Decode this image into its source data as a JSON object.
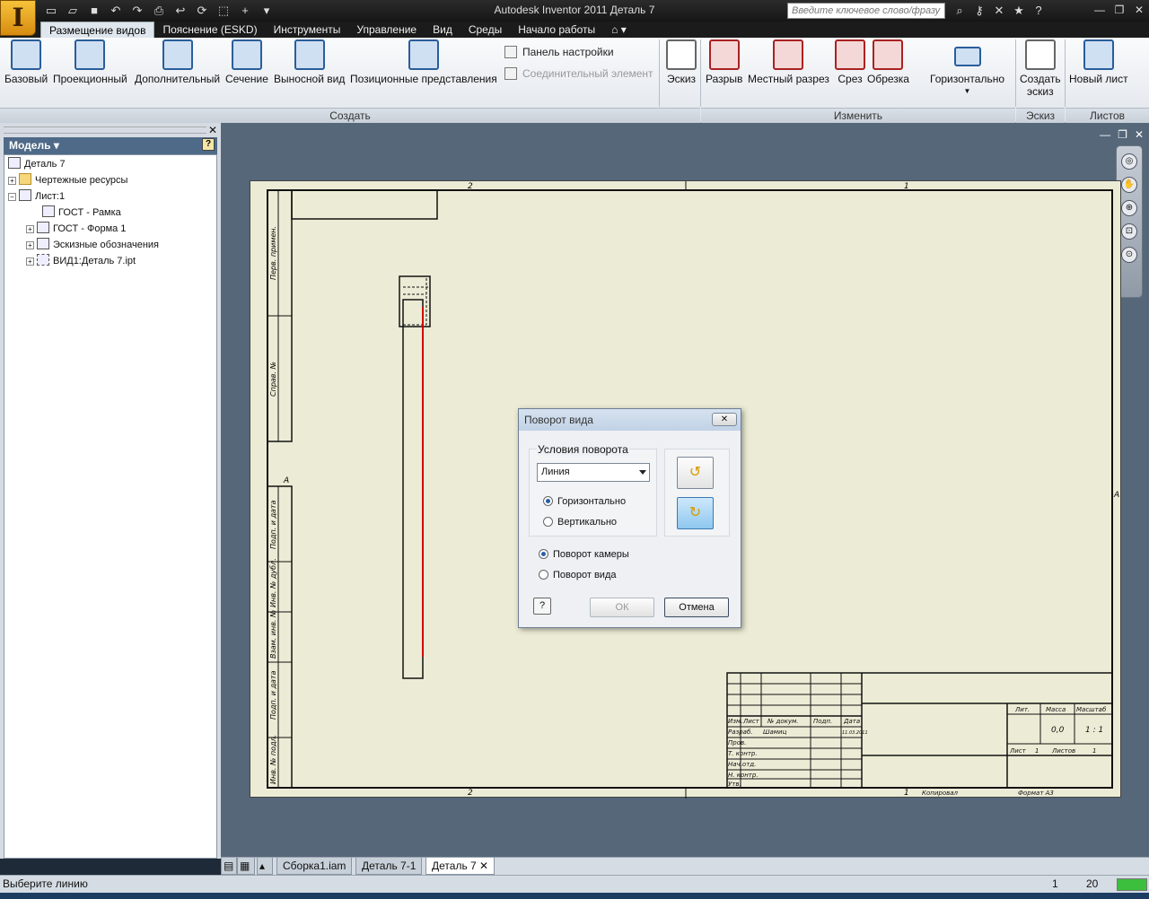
{
  "window": {
    "title": "Autodesk Inventor 2011     Деталь 7",
    "search_placeholder": "Введите ключевое слово/фразу"
  },
  "tabs": [
    "Размещение видов",
    "Пояснение (ESKD)",
    "Инструменты",
    "Управление",
    "Вид",
    "Среды",
    "Начало работы"
  ],
  "ribbon": {
    "create_buttons": [
      "Базовый",
      "Проекционный",
      "Дополнительный",
      "Сечение",
      "Выносной вид",
      "Позиционные представления"
    ],
    "small_buttons": [
      "Панель настройки",
      "Соединительный элемент"
    ],
    "sketch_button": "Эскиз",
    "modify_buttons": [
      "Разрыв",
      "Местный разрез",
      "Срез",
      "Обрезка"
    ],
    "horizontal_button": "Горизонтально",
    "create_sketch_line1": "Создать",
    "create_sketch_line2": "эскиз",
    "new_sheet_button": "Новый лист",
    "panels": {
      "create": "Создать",
      "modify": "Изменить",
      "sketch": "Эскиз",
      "sheets": "Листов"
    }
  },
  "browser": {
    "title": "Модель",
    "tree": [
      "Деталь 7",
      "Чертежные ресурсы",
      "Лист:1",
      "ГОСТ - Рамка",
      "ГОСТ - Форма 1",
      "Эскизные обозначения",
      "ВИД1:Деталь 7.ipt"
    ]
  },
  "drawing": {
    "zone_top": [
      "2",
      "1"
    ],
    "zone_bottom": [
      "2",
      "1"
    ],
    "zone_side": [
      "A",
      "A"
    ],
    "side_stamps": [
      "Перв. примен.",
      "Справ. №",
      "Подп. и дата",
      "Инв. № дубл.",
      "Взам. инв. №",
      "Подп. и дата",
      "Инв. № подл."
    ],
    "title_block": {
      "headers": [
        "Изм.",
        "Лист",
        "№ докум.",
        "Подп.",
        "Дата"
      ],
      "rows": [
        "Разраб.",
        "Пров.",
        "Т. контр.",
        "Нач.отд.",
        "Н. контр.",
        "Утв."
      ],
      "designer": "Шамиц",
      "date": "11.03.2011",
      "lit": "Лит.",
      "mass": "Масса",
      "scale": "Масштаб",
      "mass_value": "0,0",
      "scale_value": "1 : 1",
      "sheet": "Лист",
      "sheet_value": "1",
      "sheets": "Листов",
      "sheets_value": "1",
      "copied": "Копировал",
      "format": "Формат А3"
    }
  },
  "dialog": {
    "title": "Поворот вида",
    "group_label": "Условия поворота",
    "dropdown_value": "Линия",
    "opt_horizontal": "Горизонтально",
    "opt_vertical": "Вертикально",
    "opt_camera": "Поворот камеры",
    "opt_view": "Поворот вида",
    "ok": "ОК",
    "cancel": "Отмена"
  },
  "doc_tabs": [
    "Сборка1.iam",
    "Деталь 7-1",
    "Деталь 7"
  ],
  "status": {
    "message": "Выберите линию",
    "value1": "1",
    "value2": "20"
  }
}
